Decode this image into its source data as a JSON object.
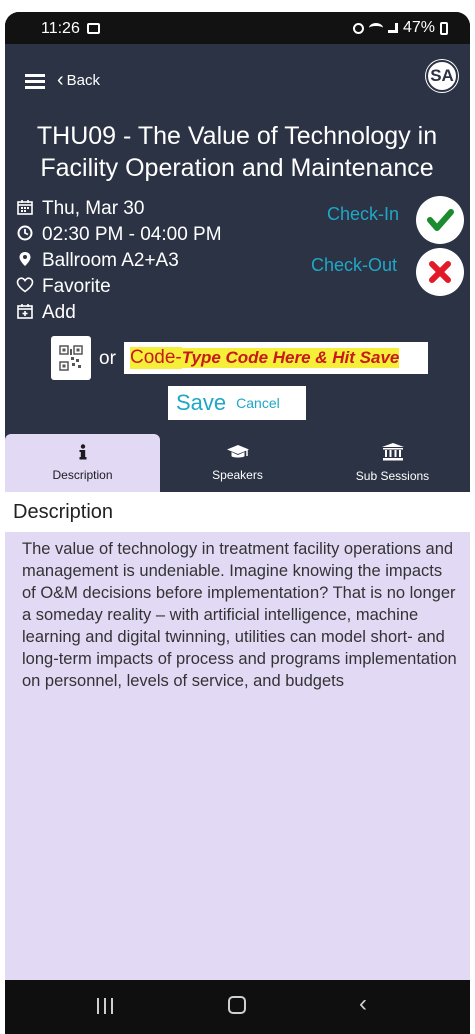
{
  "status_bar": {
    "time": "11:26",
    "battery": "47%"
  },
  "header": {
    "back_label": "Back",
    "avatar_text": "SA"
  },
  "session": {
    "title": "THU09 - The Value of Technology in Facility Operation and Maintenance",
    "date": "Thu, Mar 30",
    "time": "02:30 PM - 04:00 PM",
    "location": "Ballroom A2+A3",
    "favorite_label": "Favorite",
    "add_label": "Add"
  },
  "actions": {
    "check_in_label": "Check-In",
    "check_out_label": "Check-Out",
    "or_label": "or",
    "code_label": "Code-",
    "code_placeholder": "Type Code Here & Hit Save",
    "save_label": "Save",
    "cancel_label": "Cancel"
  },
  "tabs": [
    {
      "label": "Description",
      "icon": "info-icon",
      "active": true
    },
    {
      "label": "Speakers",
      "icon": "graduation-cap-icon",
      "active": false
    },
    {
      "label": "Sub Sessions",
      "icon": "bank-icon",
      "active": false
    }
  ],
  "description": {
    "heading": "Description",
    "text": "The value of technology in treatment facility operations and management is undeniable. Imagine knowing the impacts of O&M decisions before implementation? That is no longer a someday reality – with artificial intelligence, machine learning and digital twinning, utilities can model short- and long-term impacts of process and programs implementation on personnel, levels of service, and budgets"
  },
  "colors": {
    "app_bg": "#2c3345",
    "accent": "#1fa7c7",
    "panel_bg": "#e2d9f5",
    "check_green": "#1a8c2e",
    "check_red": "#e3192a",
    "highlight": "#f5ef3a"
  }
}
